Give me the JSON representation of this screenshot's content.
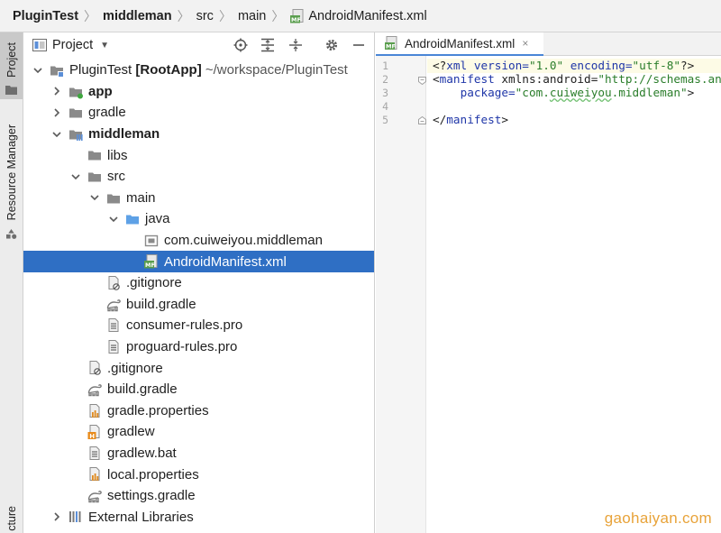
{
  "breadcrumb": [
    {
      "label": "PluginTest",
      "bold": true
    },
    {
      "label": "middleman",
      "bold": true
    },
    {
      "label": "src",
      "bold": false
    },
    {
      "label": "main",
      "bold": false
    },
    {
      "label": "AndroidManifest.xml",
      "bold": false,
      "icon": "manifest-file-icon"
    }
  ],
  "toolstrip": {
    "project_tab": "Project",
    "resource_manager_tab": "Resource Manager",
    "structure_tab_partial": "cture"
  },
  "project_panel": {
    "title": "Project",
    "header_icons": [
      "locate-icon",
      "expand-all-icon",
      "collapse-all-icon",
      "settings-icon",
      "hide-icon"
    ]
  },
  "tree": [
    {
      "label": "PluginTest",
      "extra_bold": "[RootApp]",
      "path": "~/workspace/PluginTest",
      "depth": 0,
      "arrow": "down",
      "icon": "project-folder-icon"
    },
    {
      "label": "app",
      "bold": true,
      "depth": 1,
      "arrow": "right",
      "icon": "app-module-icon"
    },
    {
      "label": "gradle",
      "depth": 1,
      "arrow": "right",
      "icon": "folder-icon"
    },
    {
      "label": "middleman",
      "bold": true,
      "depth": 1,
      "arrow": "down",
      "icon": "library-module-icon"
    },
    {
      "label": "libs",
      "depth": 2,
      "arrow": "none",
      "icon": "folder-icon"
    },
    {
      "label": "src",
      "depth": 2,
      "arrow": "down",
      "icon": "folder-icon"
    },
    {
      "label": "main",
      "depth": 3,
      "arrow": "down",
      "icon": "folder-icon"
    },
    {
      "label": "java",
      "depth": 4,
      "arrow": "down",
      "icon": "source-folder-icon"
    },
    {
      "label": "com.cuiweiyou.middleman",
      "depth": 5,
      "arrow": "none",
      "icon": "package-icon"
    },
    {
      "label": "AndroidManifest.xml",
      "depth": 5,
      "arrow": "none",
      "icon": "manifest-file-icon",
      "selected": true
    },
    {
      "label": ".gitignore",
      "depth": 3,
      "arrow": "none",
      "icon": "ignore-file-icon"
    },
    {
      "label": "build.gradle",
      "depth": 3,
      "arrow": "none",
      "icon": "gradle-file-icon"
    },
    {
      "label": "consumer-rules.pro",
      "depth": 3,
      "arrow": "none",
      "icon": "text-file-icon"
    },
    {
      "label": "proguard-rules.pro",
      "depth": 3,
      "arrow": "none",
      "icon": "text-file-icon"
    },
    {
      "label": ".gitignore",
      "depth": 2,
      "arrow": "none",
      "icon": "ignore-file-icon"
    },
    {
      "label": "build.gradle",
      "depth": 2,
      "arrow": "none",
      "icon": "gradle-file-icon"
    },
    {
      "label": "gradle.properties",
      "depth": 2,
      "arrow": "none",
      "icon": "properties-file-icon"
    },
    {
      "label": "gradlew",
      "depth": 2,
      "arrow": "none",
      "icon": "shell-file-icon"
    },
    {
      "label": "gradlew.bat",
      "depth": 2,
      "arrow": "none",
      "icon": "text-file-icon"
    },
    {
      "label": "local.properties",
      "depth": 2,
      "arrow": "none",
      "icon": "properties-file-icon"
    },
    {
      "label": "settings.gradle",
      "depth": 2,
      "arrow": "none",
      "icon": "gradle-file-icon"
    },
    {
      "label": "External Libraries",
      "depth": 1,
      "arrow": "right",
      "icon": "libraries-icon"
    }
  ],
  "editor": {
    "tab_label": "AndroidManifest.xml",
    "close_glyph": "×",
    "line_numbers": [
      "1",
      "2",
      "3",
      "4",
      "5"
    ],
    "line1": {
      "open": "<?",
      "kw": "xml",
      "a1": " version=",
      "v1": "\"1.0\"",
      "a2": " encoding=",
      "v2": "\"utf-8\"",
      "close": "?>"
    },
    "line2": {
      "open": "<",
      "tag": "manifest",
      "attr": " xmlns:android=",
      "val": "\"http://schemas.android.com/apk/res/android\""
    },
    "line3": {
      "indent": "    ",
      "attr": "package=",
      "q1": "\"com.",
      "squiggle": "cuiweiyou",
      "q2": ".middleman\"",
      "end": ">"
    },
    "line5": {
      "open": "</",
      "tag": "manifest",
      "end": ">"
    }
  },
  "watermark": "gaohaiyan.com"
}
